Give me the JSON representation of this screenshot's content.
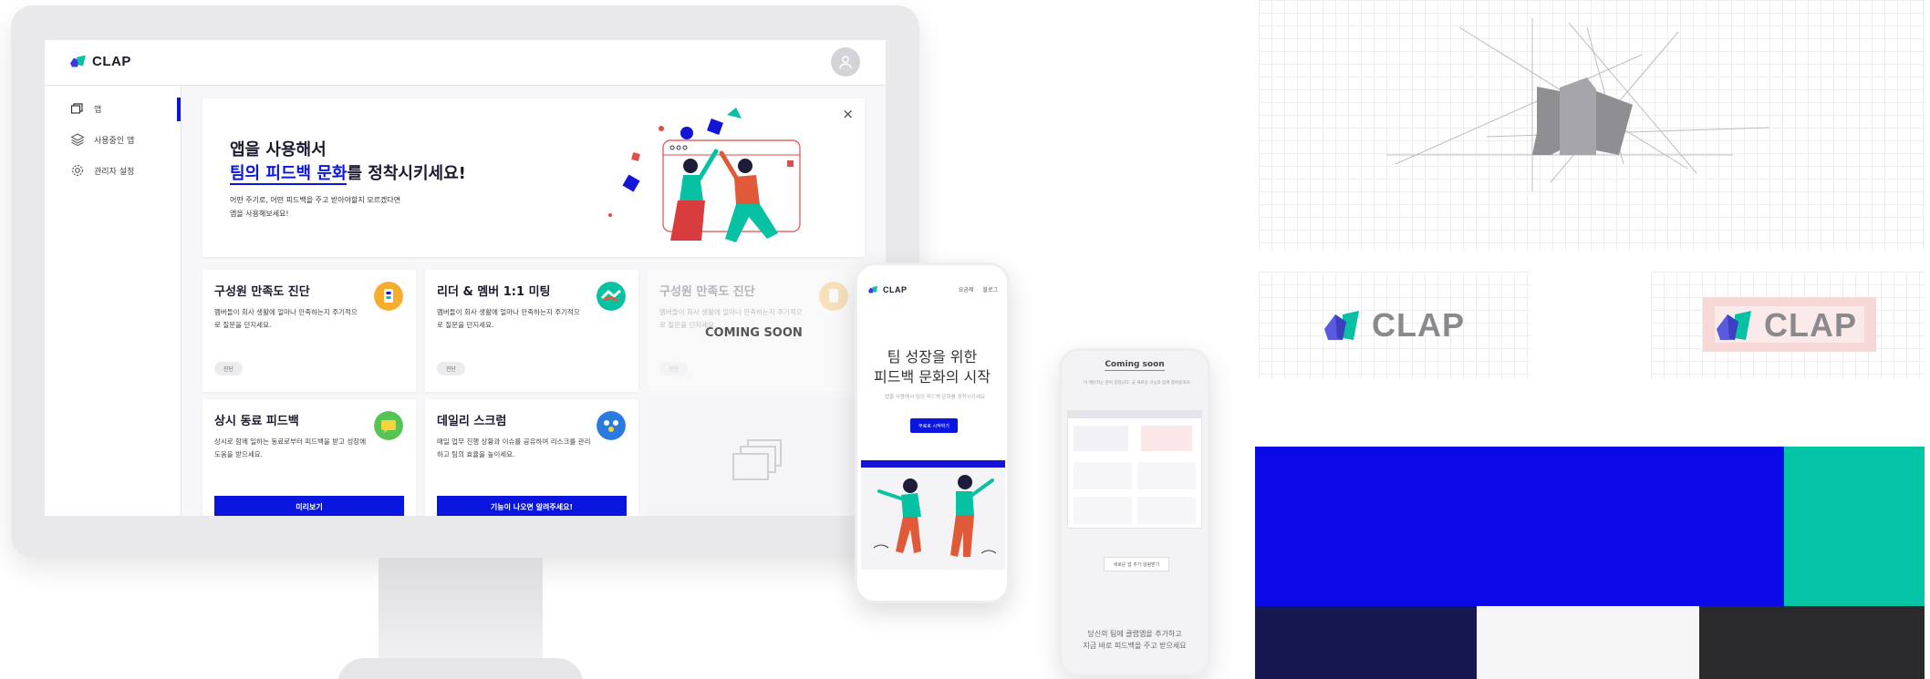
{
  "app": {
    "logo_text": "CLAP",
    "sidebar": {
      "items": [
        {
          "label": "앱"
        },
        {
          "label": "사용중인 앱"
        },
        {
          "label": "관리자 설정"
        }
      ]
    },
    "banner": {
      "title_line1": "앱을 사용해서",
      "title_highlight": "팀의 피드백 문화",
      "title_rest": "를 정착시키세요!",
      "sub_line1": "어떤 주기로, 어떤 피드백을 주고 받아야할지 모르겠다면",
      "sub_line2": "앱을 사용해보세요!",
      "close": "×"
    },
    "cards": [
      {
        "title": "구성원 만족도 진단",
        "desc": "멤버들이 회사 생활에 얼마나 만족하는지 주기적으로 질문을 던지세요.",
        "badge": "진단"
      },
      {
        "title": "리더 & 멤버 1:1 미팅",
        "desc": "멤버들이 회사 생활에 얼마나 만족하는지 주기적으로 질문을 던지세요.",
        "badge": "진단"
      },
      {
        "title": "구성원 만족도 진단",
        "desc": "멤버들이 회사 생활에 얼마나 만족하는지 주기적으로 질문을 던지세요.",
        "badge": "진단"
      },
      {
        "title": "상시 동료 피드백",
        "desc": "상시로 함께 일하는 동료로부터 피드백을 받고 성장에 도움을 받으세요.",
        "button": "미리보기"
      },
      {
        "title": "데일리 스크럼",
        "desc": "매일 업무 진행 상황과 이슈를 공유하여 리스크를 관리하고 팀의 효율을 높이세요.",
        "button": "기능이 나오면 알려주세요!"
      }
    ],
    "coming_soon": "COMING SOON"
  },
  "phone1": {
    "logo_text": "CLAP",
    "nav": [
      "요금제",
      "블로그"
    ],
    "title_line1": "팀 성장을 위한",
    "title_line2": "피드백 문화의 시작",
    "sub": "앱을 사용해서 팀의 피드백 문화를 정착시키세요",
    "button": "무료로 시작하기"
  },
  "phone2": {
    "title": "Coming soon",
    "sub": "이 페이지는 준비 중입니다. 곧 새로운 기능과 함께 찾아올게요.",
    "button": "새로운 앱 추가 알림받기",
    "foot_line1": "당신의 팀에 클랩앱을 추가하고",
    "foot_line2": "지금 바로 피드백을 주고 받으세요"
  },
  "brand": {
    "logo_word_1": "CLAP",
    "logo_word_2": "CLAP",
    "colors": {
      "primary_blue": "#0a0ae8",
      "teal": "#04c4a6",
      "navy": "#161651",
      "off_white": "#f6f6f6",
      "charcoal": "#2a2a2c"
    }
  }
}
